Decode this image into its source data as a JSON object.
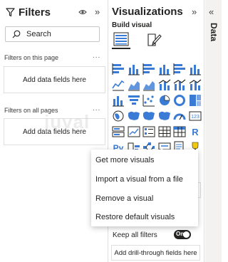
{
  "filters": {
    "title": "Filters",
    "collapse_icon": "double-chevron-right-icon",
    "search_placeholder": "Search",
    "on_this_page": {
      "label": "Filters on this page",
      "menu": "...",
      "drop_text": "Add data fields here"
    },
    "on_all_pages": {
      "label": "Filters on all pages",
      "menu": "...",
      "drop_text": "Add data fields here"
    }
  },
  "visualizations": {
    "title": "Visualizations",
    "collapse_icon": "double-chevron-right-icon",
    "build_visual_label": "Build visual",
    "more": "...",
    "keep_all_filters_label": "Keep all filters",
    "toggle_label": "On",
    "drill_through_text": "Add drill-through fields here",
    "visual_icons": [
      "stacked-bar-chart-icon",
      "stacked-column-chart-icon",
      "clustered-bar-chart-icon",
      "clustered-column-chart-icon",
      "100-stacked-bar-chart-icon",
      "100-stacked-column-chart-icon",
      "line-chart-icon",
      "area-chart-icon",
      "stacked-area-chart-icon",
      "line-and-column-chart-icon",
      "line-and-clustered-column-chart-icon",
      "ribbon-chart-icon",
      "waterfall-chart-icon",
      "funnel-icon",
      "scatter-chart-icon",
      "pie-chart-icon",
      "donut-chart-icon",
      "treemap-icon",
      "map-icon",
      "filled-map-icon",
      "shape-map-icon",
      "azure-map-icon",
      "gauge-icon",
      "card-icon",
      "multi-row-card-icon",
      "kpi-icon",
      "slicer-icon",
      "table-icon",
      "matrix-icon",
      "r-visual-icon",
      "python-visual-icon",
      "key-influencers-icon",
      "decomposition-tree-icon",
      "qa-icon",
      "smart-narrative-icon",
      "trophy-icon"
    ]
  },
  "data_pane": {
    "label": "Data",
    "expand_icon": "double-chevron-left-icon"
  },
  "context_menu": {
    "items": [
      "Get more visuals",
      "Import a visual from a file",
      "Remove a visual",
      "Restore default visuals"
    ]
  },
  "watermark": "juval",
  "colors": {
    "accent_blue": "#3a7bd5",
    "accent_yellow": "#f2c811",
    "text": "#252423",
    "border": "#e1dfdd"
  }
}
